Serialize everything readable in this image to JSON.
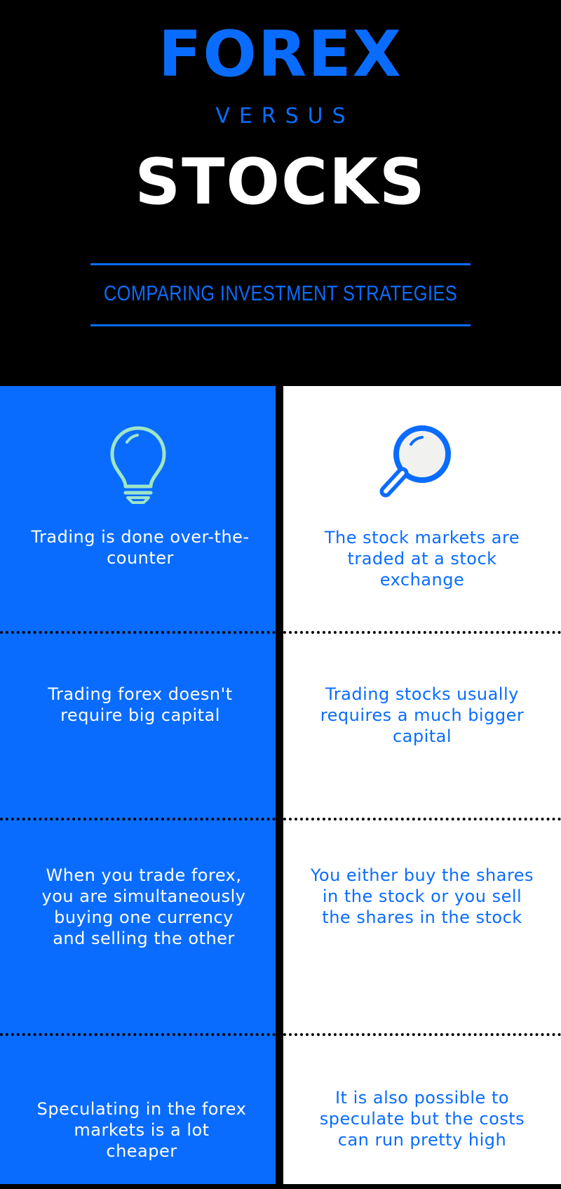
{
  "header": {
    "title_top": "FOREX",
    "versus": "VERSUS",
    "title_bottom": "STOCKS",
    "subtitle": "COMPARING INVESTMENT STRATEGIES"
  },
  "colors": {
    "accent_blue": "#0a6cff",
    "background": "#000000",
    "panel_white": "#ffffff",
    "bulb_mint": "#9ee6c6"
  },
  "icons": {
    "left": "lightbulb-icon",
    "right": "magnifying-glass-icon"
  },
  "comparison": {
    "rows": [
      {
        "forex": "Trading is done over-the-counter",
        "stocks": "The stock markets are traded at a stock exchange"
      },
      {
        "forex": "Trading forex doesn't require big capital",
        "stocks": "Trading stocks usually requires a much bigger capital"
      },
      {
        "forex": "When you trade forex, you are simultaneously buying one currency and selling the other",
        "stocks": "You either buy the shares in the stock or you sell the shares in the stock"
      },
      {
        "forex": "Speculating in the forex markets is a lot cheaper",
        "stocks": "It is also possible to speculate but the costs can run pretty high"
      }
    ]
  }
}
